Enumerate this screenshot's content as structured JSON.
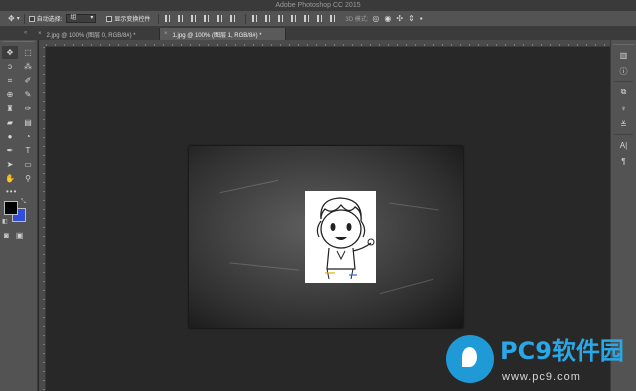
{
  "app": {
    "title": "Adobe Photoshop CC 2015"
  },
  "options_bar": {
    "auto_select_label": "自动选择:",
    "auto_select_value": "组",
    "show_transform_label": "显示变换控件",
    "mode_3d_label": "3D 模式:"
  },
  "tabs": [
    {
      "label": "2.jpg @ 100% (图层 0, RGB/8#) *",
      "active": false
    },
    {
      "label": "1.jpg @ 100% (图层 1, RGB/8#) *",
      "active": true
    }
  ],
  "tools": [
    {
      "icon": "move-icon",
      "glyph": "✥"
    },
    {
      "icon": "marquee-icon",
      "glyph": "⬚"
    },
    {
      "icon": "lasso-icon",
      "glyph": "ↄ"
    },
    {
      "icon": "magic-wand-icon",
      "glyph": "⁂"
    },
    {
      "icon": "crop-icon",
      "glyph": "⌗"
    },
    {
      "icon": "eyedropper-icon",
      "glyph": "✐"
    },
    {
      "icon": "healing-icon",
      "glyph": "⊕"
    },
    {
      "icon": "brush-icon",
      "glyph": "✎"
    },
    {
      "icon": "stamp-icon",
      "glyph": "♜"
    },
    {
      "icon": "history-brush-icon",
      "glyph": "✑"
    },
    {
      "icon": "eraser-icon",
      "glyph": "▰"
    },
    {
      "icon": "gradient-icon",
      "glyph": "▤"
    },
    {
      "icon": "blur-icon",
      "glyph": "●"
    },
    {
      "icon": "dodge-icon",
      "glyph": "◔"
    },
    {
      "icon": "pen-icon",
      "glyph": "✒"
    },
    {
      "icon": "type-icon",
      "glyph": "T"
    },
    {
      "icon": "path-select-icon",
      "glyph": "➤"
    },
    {
      "icon": "shape-icon",
      "glyph": "▭"
    },
    {
      "icon": "hand-icon",
      "glyph": "✋"
    },
    {
      "icon": "zoom-icon",
      "glyph": "⚲"
    }
  ],
  "colors": {
    "foreground": "#000000",
    "background": "#2f4fd9",
    "accent": "#2aa7e6"
  },
  "right_panel": [
    {
      "icon": "histogram-icon",
      "glyph": "▥"
    },
    {
      "icon": "info-icon",
      "glyph": "ⓘ"
    },
    {
      "icon": "properties-icon",
      "glyph": "⧉"
    },
    {
      "icon": "brush-panel-icon",
      "glyph": "♆"
    },
    {
      "icon": "adjustments-icon",
      "glyph": "≚"
    },
    {
      "icon": "character-icon",
      "glyph": "A|"
    },
    {
      "icon": "paragraph-icon",
      "glyph": "¶"
    }
  ],
  "watermark": {
    "brand": "PC9软件园",
    "url": "www.pc9.com"
  }
}
